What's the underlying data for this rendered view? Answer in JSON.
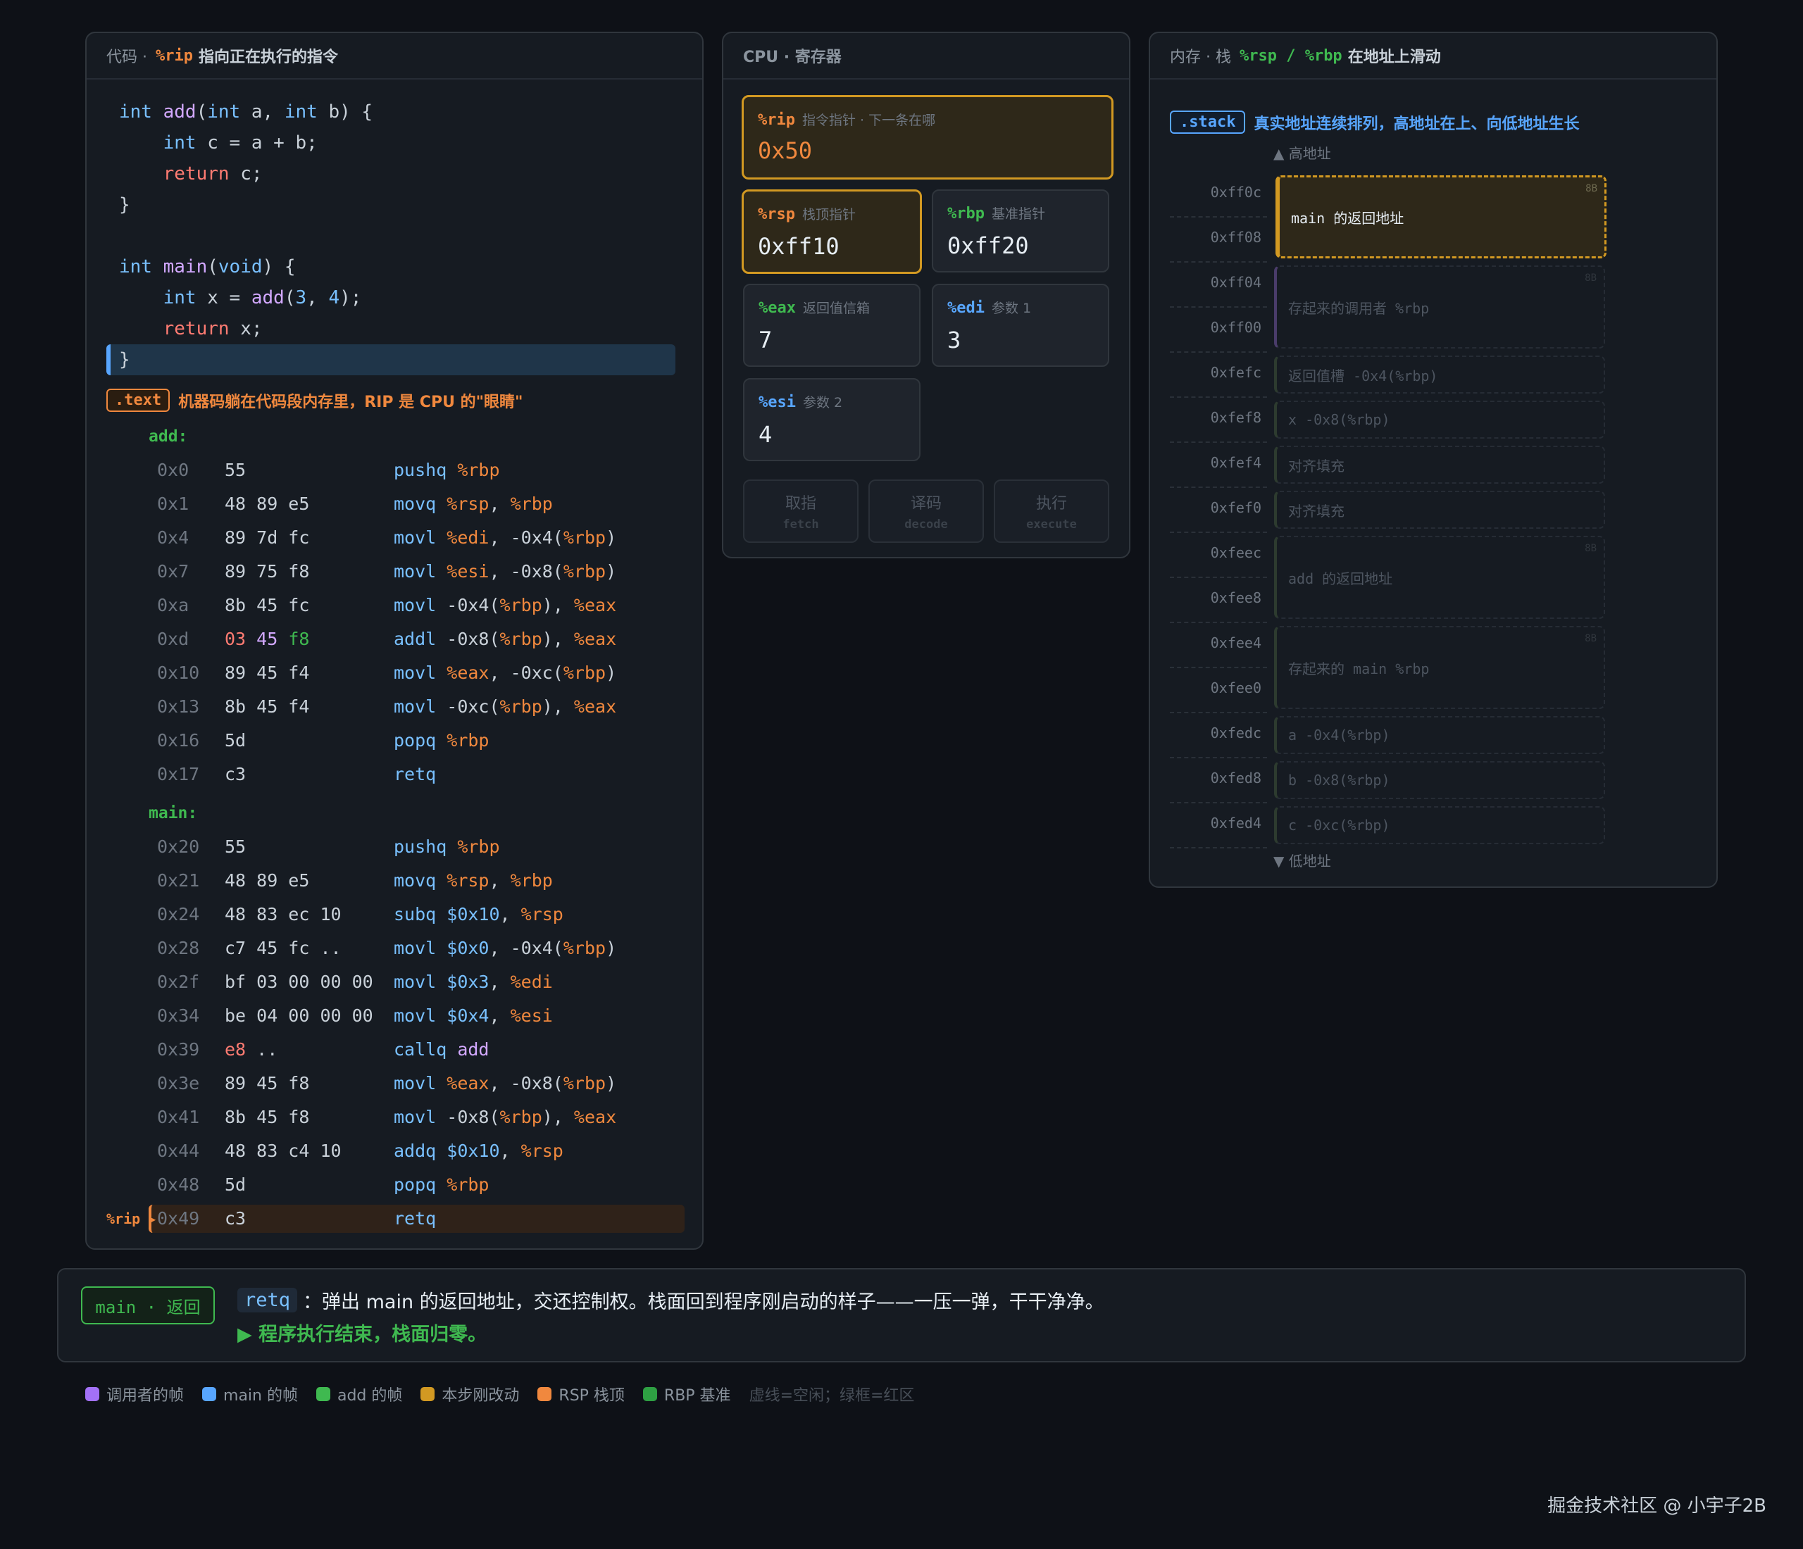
{
  "code_panel": {
    "title_prefix": "代码 ·",
    "title_reg": "%rip",
    "title_suffix": "指向正在执行的指令",
    "source": {
      "l1": {
        "kw1": "int",
        "fn": "add",
        "p1": "(",
        "kw2": "int",
        "a": " a, ",
        "kw3": "int",
        "b": " b) {"
      },
      "l2": {
        "kw": "int",
        "rest": " c = a + b;"
      },
      "l3": {
        "ret": "return",
        "rest": " c;"
      },
      "l4": "}",
      "l5": {
        "kw1": "int",
        "fn": "main",
        "p1": "(",
        "kw2": "void",
        "rest": ") {"
      },
      "l6": {
        "kw": "int",
        "mid": " x = ",
        "fn": "add",
        "p1": "(",
        "n1": "3",
        ",": ", ",
        "n2": "4",
        "end": ");"
      },
      "l7": {
        "ret": "return",
        "rest": " x;"
      },
      "l8": "}"
    },
    "text_tag": ".text",
    "text_note": "机器码躺在代码段内存里，RIP 是 CPU 的\"眼睛\"",
    "add_label": "add:",
    "main_label": "main:",
    "rip_marker": "%rip ▸",
    "add_rows": [
      {
        "addr": "0x0",
        "bytes": "55",
        "op": "pushq",
        "args": [
          [
            "reg",
            "%rbp"
          ]
        ]
      },
      {
        "addr": "0x1",
        "bytes": "48 89 e5",
        "op": "movq",
        "args": [
          [
            "reg",
            "%rsp"
          ],
          [
            "txt",
            ", "
          ],
          [
            "reg",
            "%rbp"
          ]
        ]
      },
      {
        "addr": "0x4",
        "bytes": "89 7d fc",
        "op": "movl",
        "args": [
          [
            "reg",
            "%edi"
          ],
          [
            "txt",
            ", -0x4("
          ],
          [
            "reg",
            "%rbp"
          ],
          [
            "txt",
            ")"
          ]
        ]
      },
      {
        "addr": "0x7",
        "bytes": "89 75 f8",
        "op": "movl",
        "args": [
          [
            "reg",
            "%esi"
          ],
          [
            "txt",
            ", -0x8("
          ],
          [
            "reg",
            "%rbp"
          ],
          [
            "txt",
            ")"
          ]
        ]
      },
      {
        "addr": "0xa",
        "bytes": "8b 45 fc",
        "op": "movl",
        "args": [
          [
            "txt",
            "-0x4("
          ],
          [
            "reg",
            "%rbp"
          ],
          [
            "txt",
            "), "
          ],
          [
            "reg",
            "%eax"
          ]
        ]
      },
      {
        "addr": "0xd",
        "bytes": "03 45 f8",
        "bytes_style": "mixed",
        "op": "addl",
        "args": [
          [
            "txt",
            "-0x8("
          ],
          [
            "reg",
            "%rbp"
          ],
          [
            "txt",
            "), "
          ],
          [
            "reg",
            "%eax"
          ]
        ]
      },
      {
        "addr": "0x10",
        "bytes": "89 45 f4",
        "op": "movl",
        "args": [
          [
            "reg",
            "%eax"
          ],
          [
            "txt",
            ", -0xc("
          ],
          [
            "reg",
            "%rbp"
          ],
          [
            "txt",
            ")"
          ]
        ]
      },
      {
        "addr": "0x13",
        "bytes": "8b 45 f4",
        "op": "movl",
        "args": [
          [
            "txt",
            "-0xc("
          ],
          [
            "reg",
            "%rbp"
          ],
          [
            "txt",
            "), "
          ],
          [
            "reg",
            "%eax"
          ]
        ]
      },
      {
        "addr": "0x16",
        "bytes": "5d",
        "op": "popq",
        "args": [
          [
            "reg",
            "%rbp"
          ]
        ]
      },
      {
        "addr": "0x17",
        "bytes": "c3",
        "bytes_style": "red",
        "op": "retq",
        "args": []
      }
    ],
    "main_rows": [
      {
        "addr": "0x20",
        "bytes": "55",
        "op": "pushq",
        "args": [
          [
            "reg",
            "%rbp"
          ]
        ]
      },
      {
        "addr": "0x21",
        "bytes": "48 89 e5",
        "op": "movq",
        "args": [
          [
            "reg",
            "%rsp"
          ],
          [
            "txt",
            ", "
          ],
          [
            "reg",
            "%rbp"
          ]
        ]
      },
      {
        "addr": "0x24",
        "bytes": "48 83 ec 10",
        "op": "subq",
        "args": [
          [
            "imm",
            "$0x10"
          ],
          [
            "txt",
            ", "
          ],
          [
            "reg",
            "%rsp"
          ]
        ]
      },
      {
        "addr": "0x28",
        "bytes": "c7 45 fc ..",
        "op": "movl",
        "args": [
          [
            "imm",
            "$0x0"
          ],
          [
            "txt",
            ", -0x4("
          ],
          [
            "reg",
            "%rbp"
          ],
          [
            "txt",
            ")"
          ]
        ]
      },
      {
        "addr": "0x2f",
        "bytes": "bf 03 00 00 00",
        "op": "movl",
        "args": [
          [
            "imm",
            "$0x3"
          ],
          [
            "txt",
            ", "
          ],
          [
            "reg",
            "%edi"
          ]
        ]
      },
      {
        "addr": "0x34",
        "bytes": "be 04 00 00 00",
        "op": "movl",
        "args": [
          [
            "imm",
            "$0x4"
          ],
          [
            "txt",
            ", "
          ],
          [
            "reg",
            "%esi"
          ]
        ]
      },
      {
        "addr": "0x39",
        "bytes": "e8 ..",
        "bytes_style": "e8",
        "op": "callq",
        "args": [
          [
            "fn",
            "add"
          ]
        ]
      },
      {
        "addr": "0x3e",
        "bytes": "89 45 f8",
        "op": "movl",
        "args": [
          [
            "reg",
            "%eax"
          ],
          [
            "txt",
            ", -0x8("
          ],
          [
            "reg",
            "%rbp"
          ],
          [
            "txt",
            ")"
          ]
        ]
      },
      {
        "addr": "0x41",
        "bytes": "8b 45 f8",
        "op": "movl",
        "args": [
          [
            "txt",
            "-0x8("
          ],
          [
            "reg",
            "%rbp"
          ],
          [
            "txt",
            "), "
          ],
          [
            "reg",
            "%eax"
          ]
        ]
      },
      {
        "addr": "0x44",
        "bytes": "48 83 c4 10",
        "op": "addq",
        "args": [
          [
            "imm",
            "$0x10"
          ],
          [
            "txt",
            ", "
          ],
          [
            "reg",
            "%rsp"
          ]
        ]
      },
      {
        "addr": "0x48",
        "bytes": "5d",
        "op": "popq",
        "args": [
          [
            "reg",
            "%rbp"
          ]
        ]
      },
      {
        "addr": "0x49",
        "bytes": "c3",
        "bytes_style": "red",
        "op": "retq",
        "args": [],
        "active": true
      }
    ]
  },
  "cpu_panel": {
    "title": "CPU · 寄存器",
    "rip": {
      "name": "%rip",
      "desc": "指令指针 · 下一条在哪",
      "value": "0x50"
    },
    "rsp": {
      "name": "%rsp",
      "desc": "栈顶指针",
      "value": "0xff10"
    },
    "rbp": {
      "name": "%rbp",
      "desc": "基准指针",
      "value": "0xff20"
    },
    "eax": {
      "name": "%eax",
      "desc": "返回值信箱",
      "value": "7"
    },
    "edi": {
      "name": "%edi",
      "desc": "参数 1",
      "value": "3"
    },
    "esi": {
      "name": "%esi",
      "desc": "参数 2",
      "value": "4"
    },
    "stages": [
      {
        "zh": "取指",
        "en": "fetch"
      },
      {
        "zh": "译码",
        "en": "decode"
      },
      {
        "zh": "执行",
        "en": "execute"
      }
    ]
  },
  "stack_panel": {
    "title_prefix": "内存 · 栈",
    "title_regs": "%rsp / %rbp",
    "title_suffix": "在地址上滑动",
    "tag": ".stack",
    "note": "真实地址连续排列，高地址在上、向低地址生长",
    "high_label": "▲ 高地址",
    "low_label": "▼ 低地址",
    "addresses": [
      "0xff0c",
      "0xff08",
      "0xff04",
      "0xff00",
      "0xfefc",
      "0xfef8",
      "0xfef4",
      "0xfef0",
      "0xfeec",
      "0xfee8",
      "0xfee4",
      "0xfee0",
      "0xfedc",
      "0xfed8",
      "0xfed4"
    ],
    "slots": [
      {
        "label": "main 的返回地址",
        "size": "8B",
        "live": true
      },
      {
        "label": "存起来的调用者 %rbp",
        "size": "8B"
      },
      {
        "label": "返回值槽 -0x4(%rbp)"
      },
      {
        "label": "x -0x8(%rbp)"
      },
      {
        "label": "对齐填充"
      },
      {
        "label": "对齐填充"
      },
      {
        "label": "add 的返回地址",
        "size": "8B"
      },
      {
        "label": "存起来的 main %rbp",
        "size": "8B"
      },
      {
        "label": "a -0x4(%rbp)"
      },
      {
        "label": "b -0x8(%rbp)"
      },
      {
        "label": "c -0xc(%rbp)"
      }
    ]
  },
  "status": {
    "phase": "main · 返回",
    "cmd": "retq",
    "text": "：弹出 main 的返回地址，交还控制权。栈面回到程序刚启动的样子——一压一弹，干干净净。",
    "done": "▶ 程序执行结束，栈面归零。"
  },
  "legend": {
    "items": [
      {
        "label": "调用者的帧",
        "color": "#a371f7"
      },
      {
        "label": "main 的帧",
        "color": "#58a6ff"
      },
      {
        "label": "add 的帧",
        "color": "#3fb950"
      },
      {
        "label": "本步刚改动",
        "color": "#d29922"
      },
      {
        "label": "RSP 栈顶",
        "color": "#f0883e"
      },
      {
        "label": "RBP 基准",
        "color": "#2ea043"
      }
    ],
    "note": "虚线=空闲；绿框=红区"
  },
  "credit": "掘金技术社区 @ 小宇子2B"
}
